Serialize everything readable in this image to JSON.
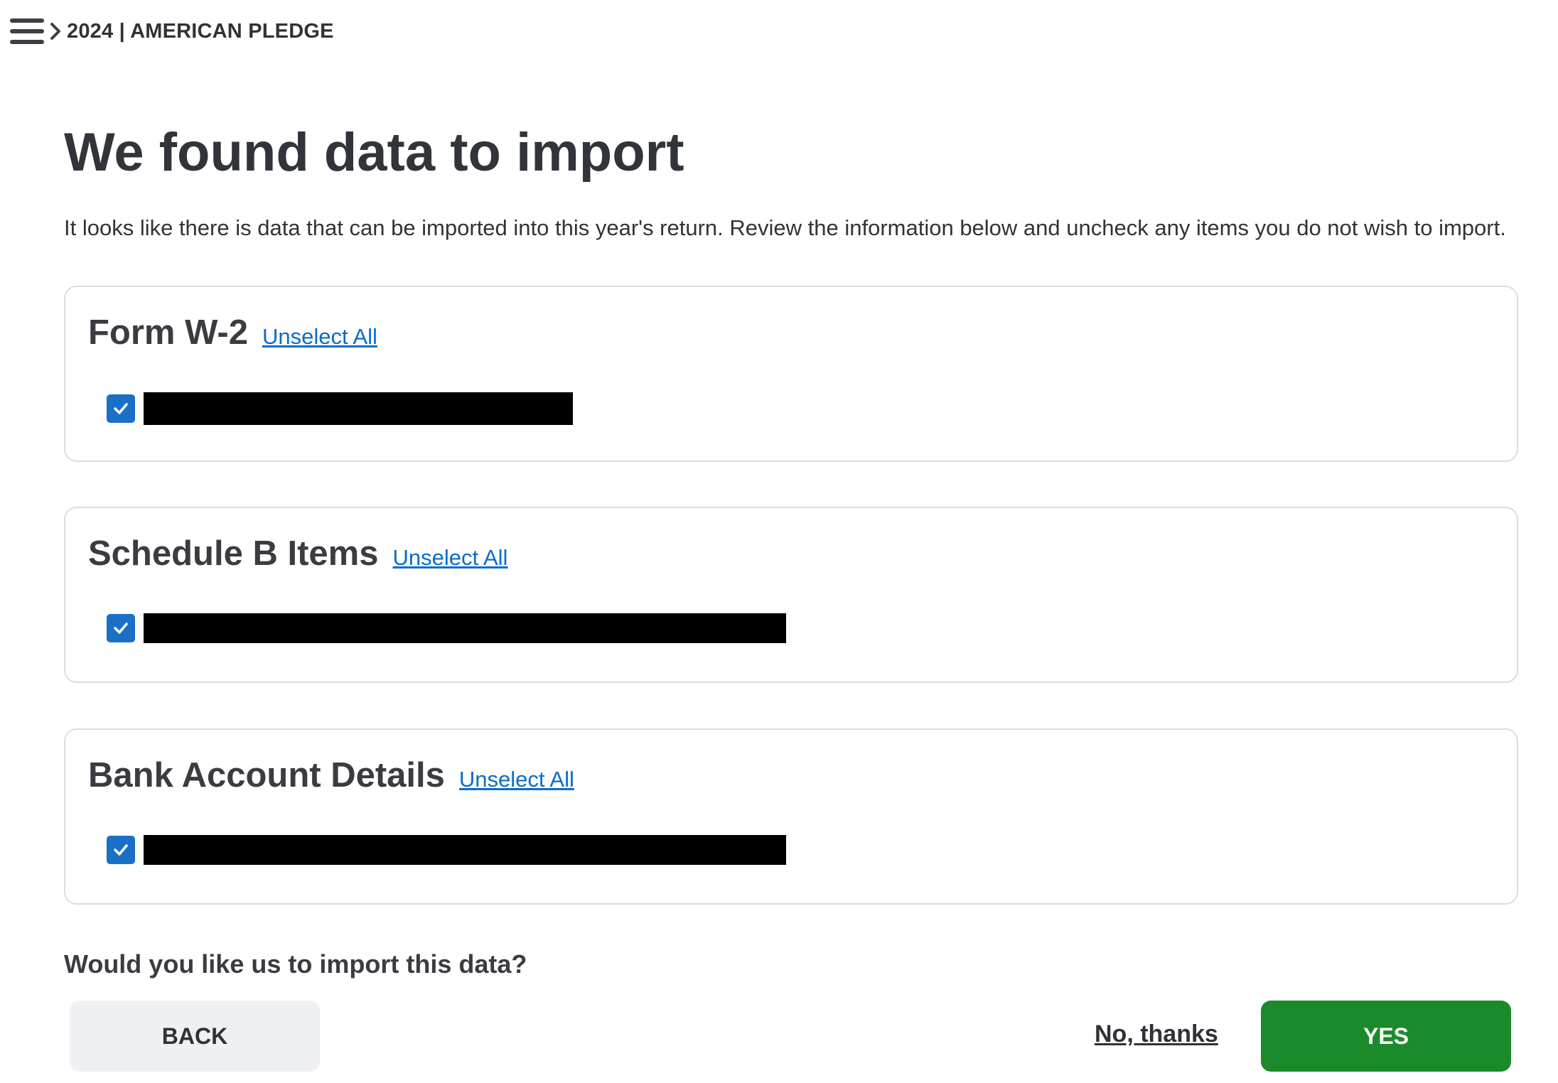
{
  "header": {
    "menu_icon": "hamburger-icon",
    "breadcrumb_icon": "chevron-right-icon",
    "title": "2024 | AMERICAN PLEDGE"
  },
  "main": {
    "heading": "We found data to import",
    "intro": "It looks like there is data that can be imported into this year's return. Review the information below and uncheck any items you do not wish to import."
  },
  "sections": [
    {
      "title": "Form W-2",
      "unselect_label": "Unselect All",
      "items": [
        {
          "checked": true,
          "label_redacted": true
        }
      ]
    },
    {
      "title": "Schedule B Items",
      "unselect_label": "Unselect All",
      "items": [
        {
          "checked": true,
          "label_redacted": true
        }
      ]
    },
    {
      "title": "Bank Account Details",
      "unselect_label": "Unselect All",
      "items": [
        {
          "checked": true,
          "label_redacted": true
        }
      ]
    }
  ],
  "footer": {
    "question": "Would you like us to import this data?",
    "back_label": "BACK",
    "no_label": "No, thanks",
    "yes_label": "YES"
  },
  "colors": {
    "accent_blue": "#1a6fc7",
    "link_blue": "#0b6cc9",
    "primary_green": "#1b8a2b",
    "secondary_button": "#eff0f4",
    "card_border": "#dcdde0",
    "redaction": "#000000"
  }
}
